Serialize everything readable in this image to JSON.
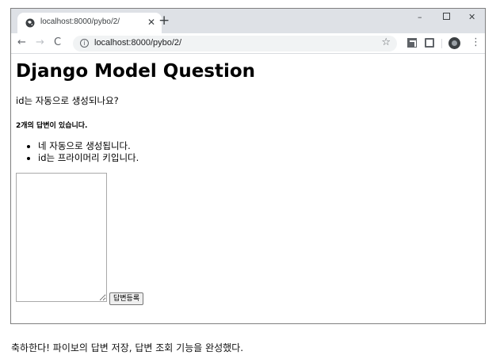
{
  "browser": {
    "tab": {
      "title": "localhost:8000/pybo/2/",
      "close": "✕"
    },
    "new_tab": "+",
    "window_controls": {
      "minimize": "–",
      "close": "✕"
    },
    "toolbar": {
      "back": "←",
      "forward": "→",
      "reload": "C",
      "info": "i",
      "url": "localhost:8000/pybo/2/",
      "bookmark": "☆",
      "menu": "⋮"
    }
  },
  "page": {
    "title": "Django Model Question",
    "question": "id는 자동으로 생성되나요?",
    "answer_count": "2개의 답변이 있습니다.",
    "answers": [
      "네 자동으로 생성됩니다.",
      "id는 프라이머리 키입니다."
    ],
    "submit_label": "답변등록"
  },
  "caption": "축하한다! 파이보의 답변 저장, 답변 조회 기능을 완성했다."
}
